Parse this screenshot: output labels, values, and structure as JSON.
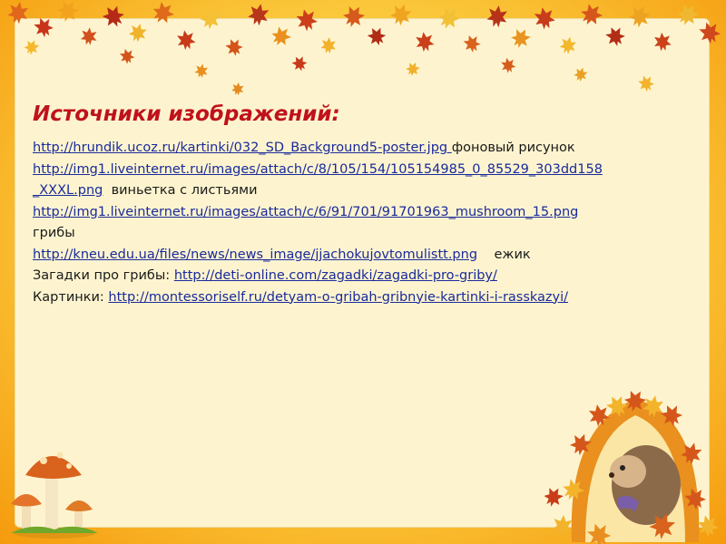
{
  "title": "Источники изображений:",
  "sources": {
    "s1_url": "http://hrundik.ucoz.ru/kartinki/032_SD_Background5-poster.jpg ",
    "s1_desc": "фоновый рисунок",
    "s2_url_a": "http://img1.liveinternet.ru/images/attach/c/8/105/154/105154985_0_85529_303dd158",
    "s2_url_b": "_XXXL.png",
    "s2_desc": "виньетка с листьями",
    "s3_url": "http://img1.liveinternet.ru/images/attach/c/6/91/701/91701963_mushroom_15.png",
    "s3_desc": "грибы",
    "s4_url": "http://kneu.edu.ua/files/news/news_image/jjachokujovtomulistt.png",
    "s4_desc": "ежик",
    "s5_label": "Загадки про грибы: ",
    "s5_url": "http://deti-online.com/zagadki/zagadki-pro-griby/",
    "s6_label": "Картинки: ",
    "s6_url": "http://montessoriself.ru/detyam-o-gribah-gribnyie-kartinki-i-rasskazyi/"
  },
  "colors": {
    "title": "#c0121b",
    "link": "#1a2a9c",
    "paper": "#fdf4cf",
    "frame": "#f7b01a"
  }
}
